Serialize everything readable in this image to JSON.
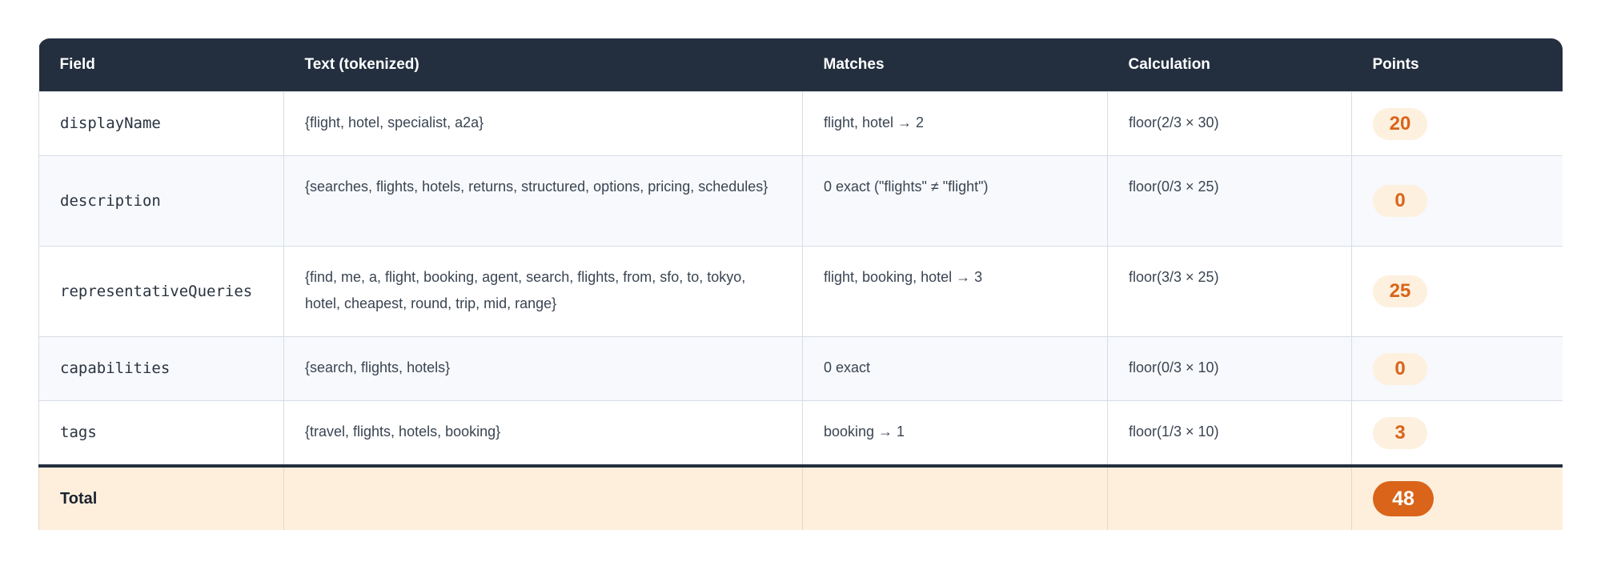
{
  "headers": {
    "field": "Field",
    "text": "Text (tokenized)",
    "matches": "Matches",
    "calculation": "Calculation",
    "points": "Points"
  },
  "rows": [
    {
      "field": "displayName",
      "text": "{flight, hotel, specialist, a2a}",
      "matches": "flight, hotel → 2",
      "calculation": "floor(2/3 × 30)",
      "points": "20"
    },
    {
      "field": "description",
      "text": "{searches, flights, hotels, returns, structured, options, pricing, schedules}",
      "matches": "0 exact (\"flights\" ≠ \"flight\")",
      "calculation": "floor(0/3 × 25)",
      "points": "0"
    },
    {
      "field": "representativeQueries",
      "text": "{find, me, a, flight, booking, agent, search, flights, from, sfo, to, tokyo, hotel, cheapest, round, trip, mid, range}",
      "matches": "flight, booking, hotel → 3",
      "calculation": "floor(3/3 × 25)",
      "points": "25"
    },
    {
      "field": "capabilities",
      "text": "{search, flights, hotels}",
      "matches": "0 exact",
      "calculation": "floor(0/3 × 10)",
      "points": "0"
    },
    {
      "field": "tags",
      "text": "{travel, flights, hotels, booking}",
      "matches": "booking → 1",
      "calculation": "floor(1/3 × 10)",
      "points": "3"
    }
  ],
  "total": {
    "label": "Total",
    "points": "48"
  },
  "colors": {
    "header_bg": "#232f3f",
    "accent": "#d9641a",
    "pill_bg": "#fdf0de",
    "total_bg": "#feefdc"
  }
}
